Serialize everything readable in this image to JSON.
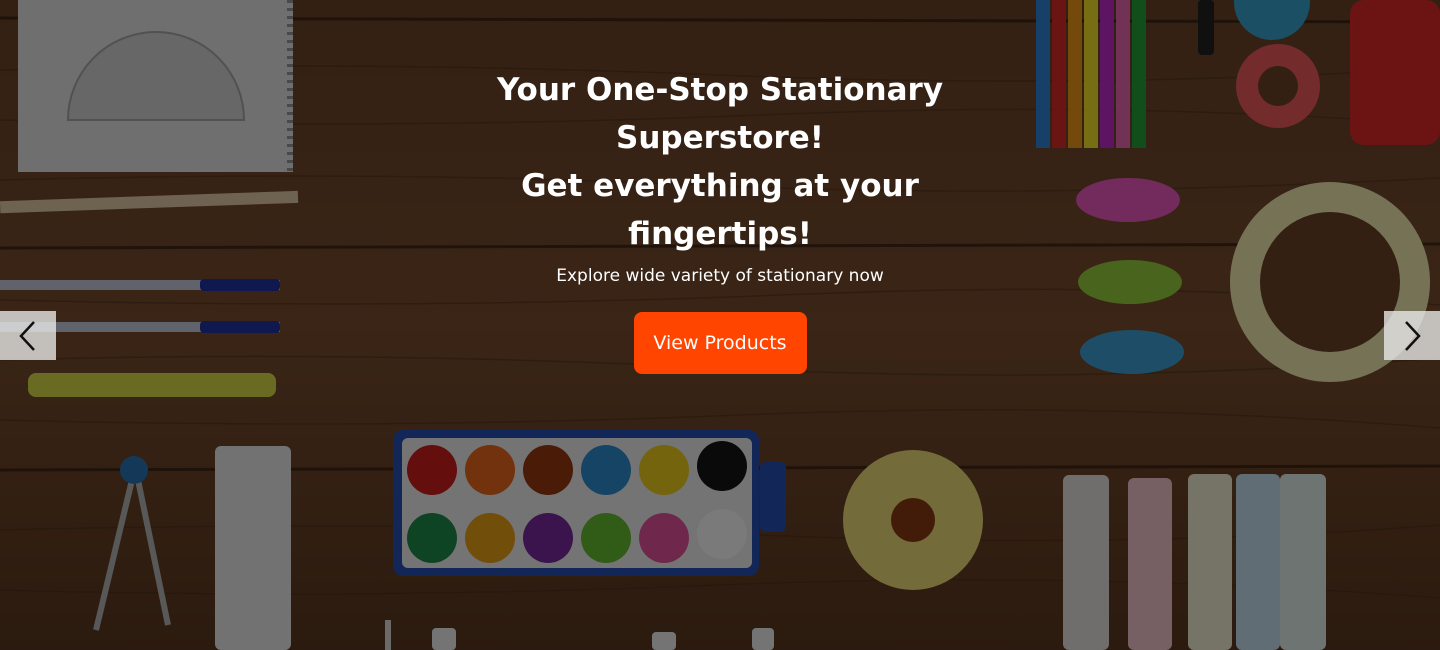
{
  "hero": {
    "headline_line1": "Your One-Stop Stationary",
    "headline_line2": "Superstore!",
    "headline_line3": "Get everything at your",
    "headline_line4": "fingertips!",
    "subheadline": "Explore wide variety of stationary now",
    "cta_label": "View Products",
    "cta_color": "#ff4500",
    "background_scene": "stationery-on-wooden-table"
  },
  "carousel": {
    "prev_icon": "chevron-left-icon",
    "next_icon": "chevron-right-icon"
  }
}
